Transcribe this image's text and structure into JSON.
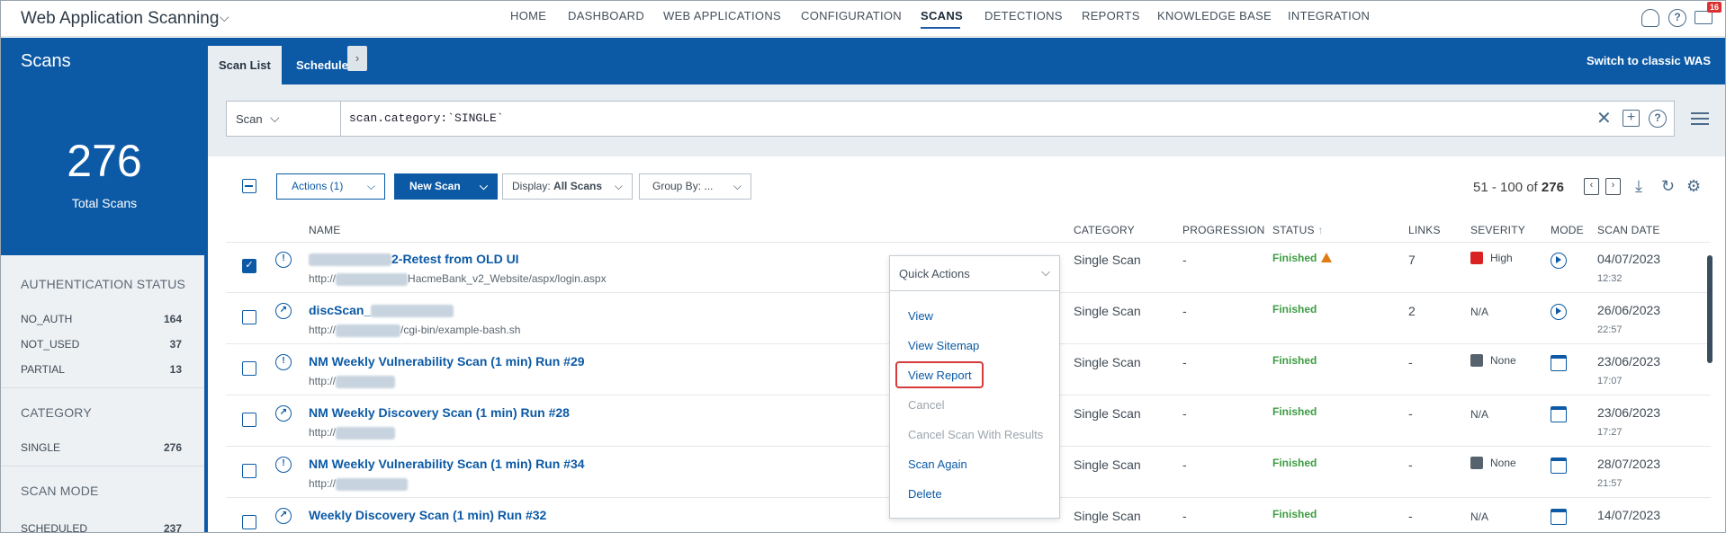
{
  "app": {
    "title": "Web Application Scanning"
  },
  "nav": [
    "HOME",
    "DASHBOARD",
    "WEB APPLICATIONS",
    "CONFIGURATION",
    "SCANS",
    "DETECTIONS",
    "REPORTS",
    "KNOWLEDGE BASE",
    "INTEGRATION"
  ],
  "nav_active": "SCANS",
  "header_icons": {
    "user": "user-icon",
    "help": "help-icon",
    "mail": "mail-icon",
    "mail_badge": "16"
  },
  "section": {
    "title": "Scans",
    "tabs": [
      "Scan List",
      "Schedule"
    ],
    "active_tab": "Scan List",
    "switch_label": "Switch to classic WAS"
  },
  "summary": {
    "count": "276",
    "label": "Total Scans"
  },
  "filters": [
    {
      "title": "AUTHENTICATION STATUS",
      "items": [
        {
          "label": "NO_AUTH",
          "count": "164"
        },
        {
          "label": "NOT_USED",
          "count": "37"
        },
        {
          "label": "PARTIAL",
          "count": "13"
        }
      ]
    },
    {
      "title": "CATEGORY",
      "items": [
        {
          "label": "SINGLE",
          "count": "276"
        }
      ]
    },
    {
      "title": "SCAN MODE",
      "items": [
        {
          "label": "SCHEDULED",
          "count": "237"
        }
      ]
    }
  ],
  "search": {
    "scope": "Scan",
    "query": "scan.category:`SINGLE`"
  },
  "toolbar": {
    "actions": "Actions (1)",
    "new_scan": "New Scan",
    "display_label": "Display:",
    "display_value": "All Scans",
    "group_by": "Group By: ...",
    "range": "51 - 100 of",
    "total": "276"
  },
  "columns": [
    "NAME",
    "CATEGORY",
    "PROGRESSION",
    "STATUS",
    "LINKS",
    "SEVERITY",
    "MODE",
    "SCAN DATE"
  ],
  "sort_indicator": "↑",
  "rows": [
    {
      "name": "2-Retest from OLD UI",
      "url_pre": "http://",
      "url_post": "HacmeBank_v2_Website/aspx/login.aspx",
      "category": "Single Scan",
      "progression": "-",
      "status": "Finished",
      "warn": true,
      "links": "7",
      "severity": "High",
      "sev_color": "#d92323",
      "mode": "on-demand",
      "date": "04/07/2023",
      "time": "12:32",
      "checked": true,
      "type": "vuln"
    },
    {
      "name": "discScan_",
      "url_pre": "http://",
      "url_post": "/cgi-bin/example-bash.sh",
      "category": "Single Scan",
      "progression": "-",
      "status": "Finished",
      "warn": false,
      "links": "2",
      "severity": "N/A",
      "sev_color": "",
      "mode": "on-demand",
      "date": "26/06/2023",
      "time": "22:57",
      "checked": false,
      "type": "disc"
    },
    {
      "name": "NM Weekly Vulnerability Scan (1 min) Run #29",
      "url_pre": "http://",
      "url_post": "",
      "category": "Single Scan",
      "progression": "-",
      "status": "Finished",
      "warn": false,
      "links": "-",
      "severity": "None",
      "sev_color": "#56636e",
      "mode": "scheduled",
      "date": "23/06/2023",
      "time": "17:07",
      "checked": false,
      "type": "vuln"
    },
    {
      "name": "NM Weekly Discovery Scan (1 min) Run #28",
      "url_pre": "http://",
      "url_post": "",
      "category": "Single Scan",
      "progression": "-",
      "status": "Finished",
      "warn": false,
      "links": "-",
      "severity": "N/A",
      "sev_color": "",
      "mode": "scheduled",
      "date": "23/06/2023",
      "time": "17:27",
      "checked": false,
      "type": "disc"
    },
    {
      "name": "NM Weekly Vulnerability Scan (1 min) Run #34",
      "url_pre": "http://",
      "url_post": "",
      "category": "Single Scan",
      "progression": "-",
      "status": "Finished",
      "warn": false,
      "links": "-",
      "severity": "None",
      "sev_color": "#56636e",
      "mode": "scheduled",
      "date": "28/07/2023",
      "time": "21:57",
      "checked": false,
      "type": "vuln"
    },
    {
      "name": "Weekly Discovery Scan (1 min) Run #32",
      "url_pre": "",
      "url_post": "",
      "category": "Single Scan",
      "progression": "-",
      "status": "Finished",
      "warn": false,
      "links": "-",
      "severity": "N/A",
      "sev_color": "",
      "mode": "scheduled",
      "date": "14/07/2023",
      "time": "",
      "checked": false,
      "type": "disc"
    }
  ],
  "quick_actions": {
    "title": "Quick Actions",
    "items": [
      {
        "label": "View",
        "disabled": false
      },
      {
        "label": "View Sitemap",
        "disabled": false
      },
      {
        "label": "View Report",
        "disabled": false,
        "highlighted": true
      },
      {
        "label": "Cancel",
        "disabled": true
      },
      {
        "label": "Cancel Scan With Results",
        "disabled": true
      },
      {
        "label": "Scan Again",
        "disabled": false
      },
      {
        "label": "Delete",
        "disabled": false
      }
    ]
  },
  "colors": {
    "brand": "#0c5aa6",
    "finished": "#3d9c42",
    "high": "#d92323",
    "highlight": "#d63a3a"
  }
}
